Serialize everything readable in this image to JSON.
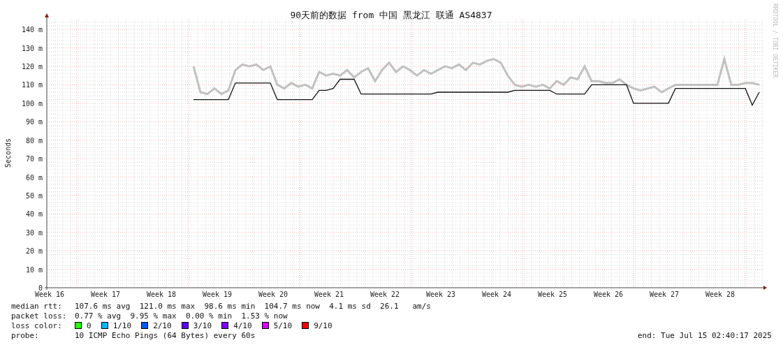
{
  "title": "90天前的数据 from 中国 黑龙江 联通 AS4837",
  "watermark": "RRDTOOL / TOBI OETIKER",
  "chart_data": {
    "type": "line",
    "ylabel": "Seconds",
    "grid": true,
    "ylim": [
      0,
      145
    ],
    "categories": [
      "Week 16",
      null,
      null,
      null,
      null,
      null,
      null,
      null,
      "Week 17",
      null,
      null,
      null,
      null,
      null,
      null,
      null,
      "Week 18",
      null,
      null,
      null,
      null,
      null,
      null,
      null,
      "Week 19",
      null,
      null,
      null,
      null,
      null,
      null,
      null,
      "Week 20",
      null,
      null,
      null,
      null,
      null,
      null,
      null,
      "Week 21",
      null,
      null,
      null,
      null,
      null,
      null,
      null,
      "Week 22",
      null,
      null,
      null,
      null,
      null,
      null,
      null,
      "Week 23",
      null,
      null,
      null,
      null,
      null,
      null,
      null,
      "Week 24",
      null,
      null,
      null,
      null,
      null,
      null,
      null,
      "Week 25",
      null,
      null,
      null,
      null,
      null,
      null,
      null,
      "Week 26",
      null,
      null,
      null,
      null,
      null,
      null,
      null,
      "Week 27",
      null,
      null,
      null,
      null,
      null,
      null,
      null,
      "Week 28",
      null,
      null,
      null,
      null,
      null,
      null
    ],
    "yticks": [
      {
        "value": 0,
        "label": "0"
      },
      {
        "value": 10,
        "label": "10 m"
      },
      {
        "value": 20,
        "label": "20 m"
      },
      {
        "value": 30,
        "label": "30 m"
      },
      {
        "value": 40,
        "label": "40 m"
      },
      {
        "value": 50,
        "label": "50 m"
      },
      {
        "value": 60,
        "label": "60 m"
      },
      {
        "value": 70,
        "label": "70 m"
      },
      {
        "value": 80,
        "label": "80 m"
      },
      {
        "value": 90,
        "label": "90 m"
      },
      {
        "value": 100,
        "label": "100 m"
      },
      {
        "value": 110,
        "label": "110 m"
      },
      {
        "value": 120,
        "label": "120 m"
      },
      {
        "value": 130,
        "label": "130 m"
      },
      {
        "value": 140,
        "label": "140 m"
      }
    ],
    "series": [
      {
        "color": "#a8a8a8",
        "values": [
          null,
          null,
          null,
          null,
          null,
          null,
          null,
          null,
          null,
          null,
          null,
          null,
          null,
          null,
          null,
          null,
          null,
          null,
          null,
          null,
          null,
          120,
          106,
          105,
          108,
          105,
          107,
          118,
          121,
          120,
          121,
          118,
          120,
          110,
          108,
          111,
          109,
          110,
          108,
          117,
          115,
          116,
          115,
          118,
          114,
          117,
          119,
          112,
          118,
          122,
          117,
          120,
          118,
          115,
          118,
          116,
          118,
          120,
          119,
          121,
          118,
          122,
          121,
          123,
          124,
          122,
          115,
          110,
          109,
          110,
          109,
          110,
          108,
          112,
          110,
          114,
          113,
          120,
          112,
          112,
          111,
          111,
          113,
          110,
          108,
          107,
          108,
          109,
          106,
          108,
          110,
          110,
          110,
          110,
          110,
          110,
          110,
          124,
          110,
          110,
          111,
          111,
          110
        ]
      },
      {
        "color": "#111111",
        "values": [
          null,
          null,
          null,
          null,
          null,
          null,
          null,
          null,
          null,
          null,
          null,
          null,
          null,
          null,
          null,
          null,
          null,
          null,
          null,
          null,
          null,
          102,
          102,
          102,
          102,
          102,
          102,
          111,
          111,
          111,
          111,
          111,
          111,
          102,
          102,
          102,
          102,
          102,
          102,
          107,
          107,
          108,
          113,
          113,
          113,
          105,
          105,
          105,
          105,
          105,
          105,
          105,
          105,
          105,
          105,
          105,
          106,
          106,
          106,
          106,
          106,
          106,
          106,
          106,
          106,
          106,
          106,
          107,
          107,
          107,
          107,
          107,
          107,
          105,
          105,
          105,
          105,
          105,
          110,
          110,
          110,
          110,
          110,
          110,
          100,
          100,
          100,
          100,
          100,
          100,
          108,
          108,
          108,
          108,
          108,
          108,
          108,
          108,
          108,
          108,
          108,
          99,
          106
        ]
      }
    ]
  },
  "legend": {
    "median_rtt": {
      "label": "median rtt:",
      "text": "107.6 ms avg  121.0 ms max  98.6 ms min  104.7 ms now  4.1 ms sd  26.1   am/s"
    },
    "packet_loss": {
      "label": "packet loss:",
      "text": "0.77 % avg  9.95 % max  0.00 % min  1.53 % now"
    },
    "loss_color": {
      "label": "loss color:",
      "items": [
        {
          "label": "0",
          "color": "#26ff00"
        },
        {
          "label": "1/10",
          "color": "#00b8ff"
        },
        {
          "label": "2/10",
          "color": "#0059ff"
        },
        {
          "label": "3/10",
          "color": "#5e00ff"
        },
        {
          "label": "4/10",
          "color": "#7e00ff"
        },
        {
          "label": "5/10",
          "color": "#dd00ff"
        },
        {
          "label": "9/10",
          "color": "#ff0000"
        }
      ]
    },
    "probe": {
      "label": "probe:",
      "text": "10 ICMP Echo Pings (64 Bytes) every 60s"
    },
    "end": "end: Tue Jul 15 02:40:17 2025"
  }
}
